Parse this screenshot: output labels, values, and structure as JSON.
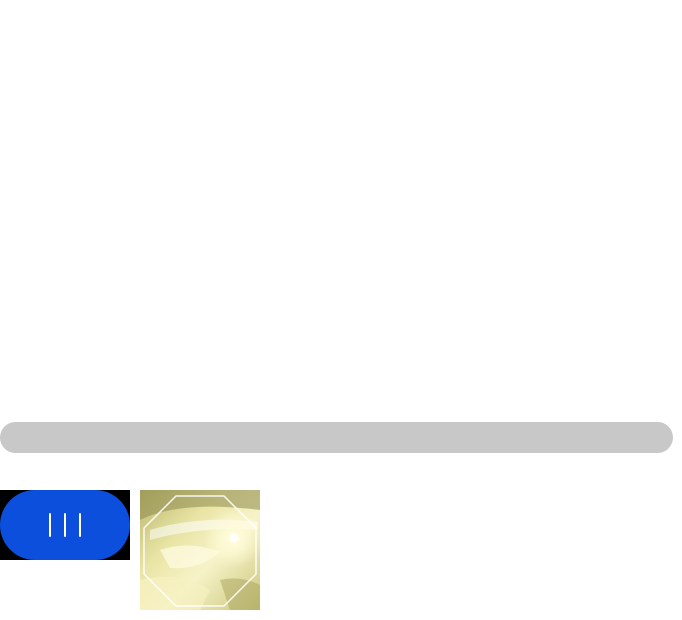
{
  "progress": {
    "fraction": 0.0,
    "track_color": "#c8c8c8"
  },
  "control_button": {
    "icon": "three-vertical-bars-icon",
    "color": "#0b4fdc"
  },
  "thumbnail": {
    "icon": "octagon-frame-icon",
    "description_colors": [
      "#e8e4a8",
      "#fffbe0",
      "#b8b46a"
    ]
  }
}
